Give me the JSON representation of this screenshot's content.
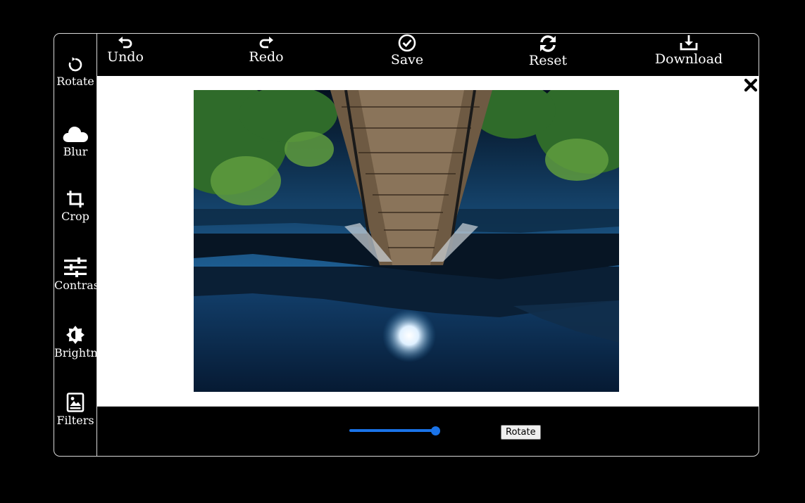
{
  "sidebar": {
    "items": [
      {
        "label": "Rotate",
        "icon": "rotate-icon"
      },
      {
        "label": "Blur",
        "icon": "cloud-icon"
      },
      {
        "label": "Crop",
        "icon": "crop-icon"
      },
      {
        "label": "Contrast",
        "icon": "sliders-icon"
      },
      {
        "label": "Brightness",
        "icon": "brightness-icon"
      },
      {
        "label": "Filters",
        "icon": "image-icon"
      }
    ]
  },
  "toolbar": {
    "items": [
      {
        "label": "Undo",
        "icon": "undo-icon"
      },
      {
        "label": "Redo",
        "icon": "redo-icon"
      },
      {
        "label": "Save",
        "icon": "check-circle-icon"
      },
      {
        "label": "Reset",
        "icon": "refresh-icon"
      },
      {
        "label": "Download",
        "icon": "download-icon"
      }
    ]
  },
  "canvas": {
    "close_icon": "close-icon",
    "image_rotation_degrees": 180
  },
  "controls": {
    "slider_value_fraction": 1.0,
    "rotate_button_label": "Rotate"
  },
  "colors": {
    "background": "#000000",
    "canvas": "#ffffff",
    "accent": "#1a73e8",
    "border": "#d8d8d8"
  }
}
